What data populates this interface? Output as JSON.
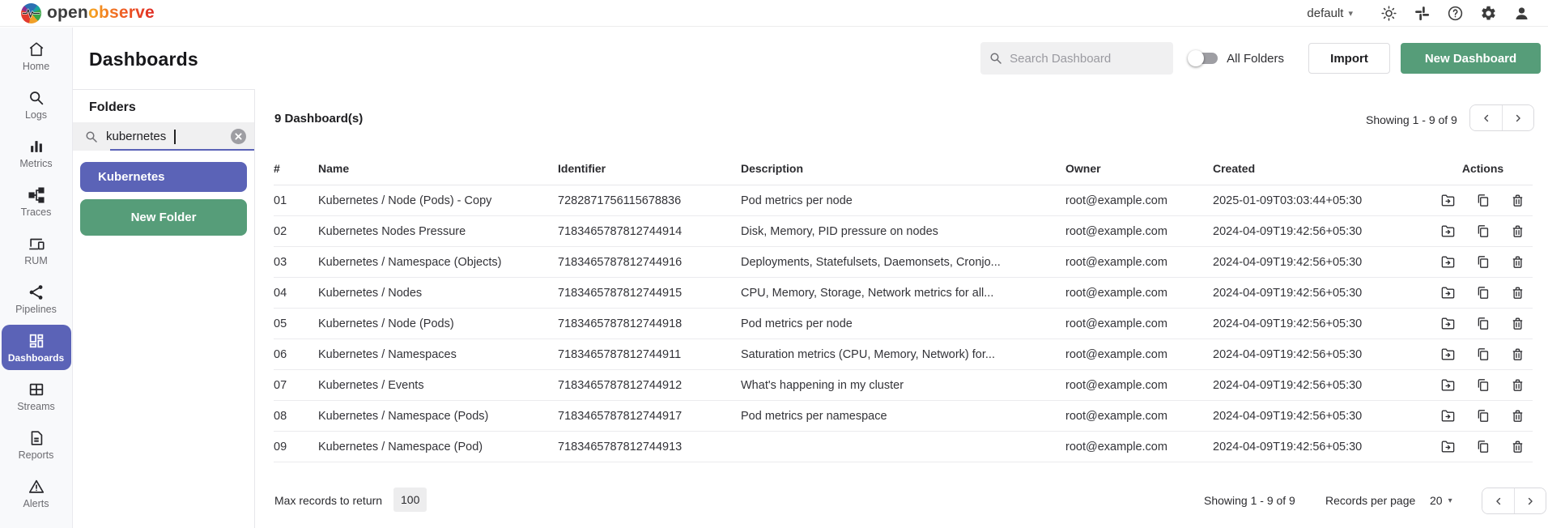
{
  "topbar": {
    "brand_open": "open",
    "brand_observe": "observe",
    "org": "default"
  },
  "header": {
    "title": "Dashboards",
    "search_placeholder": "Search Dashboard",
    "all_folders": "All Folders",
    "import": "Import",
    "new_dashboard": "New Dashboard"
  },
  "sidebar": {
    "items": [
      {
        "label": "Home",
        "icon": "home-icon"
      },
      {
        "label": "Logs",
        "icon": "search-icon"
      },
      {
        "label": "Metrics",
        "icon": "bar-chart-icon"
      },
      {
        "label": "Traces",
        "icon": "tree-icon"
      },
      {
        "label": "RUM",
        "icon": "devices-icon"
      },
      {
        "label": "Pipelines",
        "icon": "share-icon"
      },
      {
        "label": "Dashboards",
        "icon": "dashboard-icon",
        "active": true
      },
      {
        "label": "Streams",
        "icon": "grid-icon"
      },
      {
        "label": "Reports",
        "icon": "document-icon"
      },
      {
        "label": "Alerts",
        "icon": "warning-icon"
      }
    ]
  },
  "folders": {
    "heading": "Folders",
    "search_value": "kubernetes",
    "selected_folder": "Kubernetes",
    "new_folder": "New Folder"
  },
  "table": {
    "count": "9 Dashboard(s)",
    "showing": "Showing 1 - 9 of 9",
    "headers": [
      "#",
      "Name",
      "Identifier",
      "Description",
      "Owner",
      "Created",
      "Actions"
    ],
    "rows": [
      {
        "num": "01",
        "name": "Kubernetes / Node (Pods) - Copy",
        "identifier": "7282871756115678836",
        "description": "Pod metrics per node",
        "owner": "root@example.com",
        "created": "2025-01-09T03:03:44+05:30"
      },
      {
        "num": "02",
        "name": "Kubernetes Nodes Pressure",
        "identifier": "7183465787812744914",
        "description": "Disk, Memory, PID pressure on nodes",
        "owner": "root@example.com",
        "created": "2024-04-09T19:42:56+05:30"
      },
      {
        "num": "03",
        "name": "Kubernetes / Namespace (Objects)",
        "identifier": "7183465787812744916",
        "description": "Deployments, Statefulsets, Daemonsets, Cronjo...",
        "owner": "root@example.com",
        "created": "2024-04-09T19:42:56+05:30"
      },
      {
        "num": "04",
        "name": "Kubernetes / Nodes",
        "identifier": "7183465787812744915",
        "description": "CPU, Memory, Storage, Network metrics for all...",
        "owner": "root@example.com",
        "created": "2024-04-09T19:42:56+05:30"
      },
      {
        "num": "05",
        "name": "Kubernetes / Node (Pods)",
        "identifier": "7183465787812744918",
        "description": "Pod metrics per node",
        "owner": "root@example.com",
        "created": "2024-04-09T19:42:56+05:30"
      },
      {
        "num": "06",
        "name": "Kubernetes / Namespaces",
        "identifier": "7183465787812744911",
        "description": "Saturation metrics (CPU, Memory, Network) for...",
        "owner": "root@example.com",
        "created": "2024-04-09T19:42:56+05:30"
      },
      {
        "num": "07",
        "name": "Kubernetes / Events",
        "identifier": "7183465787812744912",
        "description": "What's happening in my cluster",
        "owner": "root@example.com",
        "created": "2024-04-09T19:42:56+05:30"
      },
      {
        "num": "08",
        "name": "Kubernetes / Namespace (Pods)",
        "identifier": "7183465787812744917",
        "description": "Pod metrics per namespace",
        "owner": "root@example.com",
        "created": "2024-04-09T19:42:56+05:30"
      },
      {
        "num": "09",
        "name": "Kubernetes / Namespace (Pod)",
        "identifier": "7183465787812744913",
        "description": "",
        "owner": "root@example.com",
        "created": "2024-04-09T19:42:56+05:30"
      }
    ]
  },
  "footer": {
    "max_records_label": "Max records to return",
    "max_records_value": "100",
    "showing": "Showing 1 - 9 of 9",
    "records_per_page_label": "Records per page",
    "records_per_page_value": "20"
  },
  "colors": {
    "primary_indigo": "#5b63b7",
    "action_green": "#569d79",
    "brand_orange": "#ee5a24",
    "input_gray": "#f0f0f1"
  }
}
